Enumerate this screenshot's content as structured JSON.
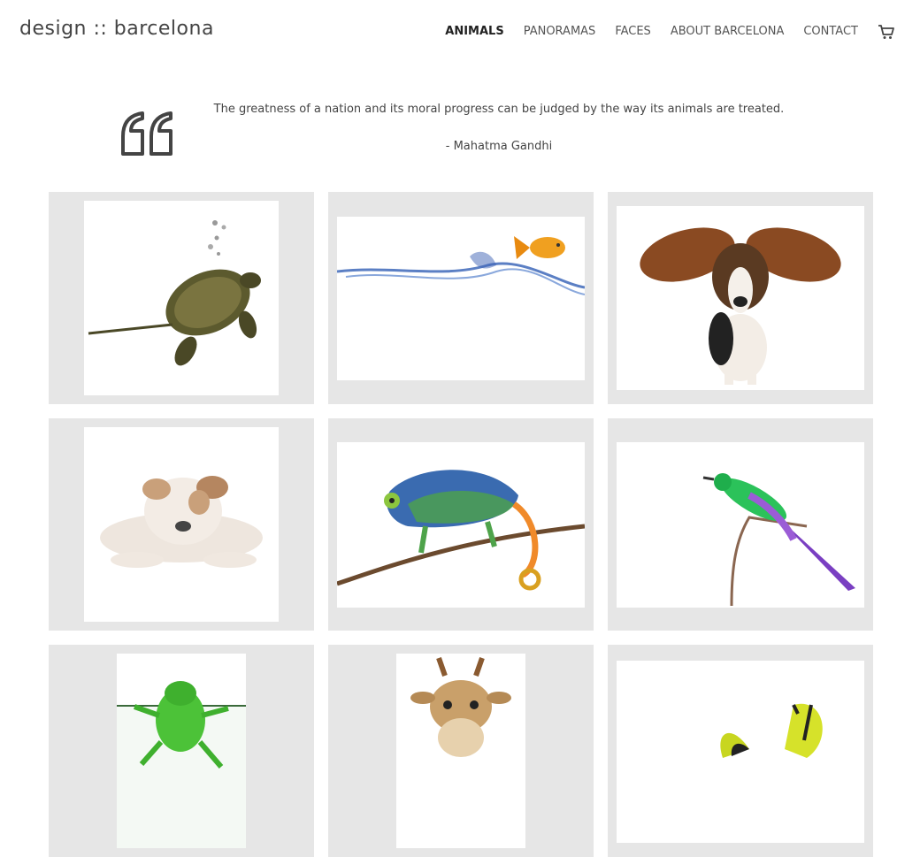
{
  "brand": "design :: barcelona",
  "nav": [
    {
      "label": "ANIMALS",
      "active": true
    },
    {
      "label": "PANORAMAS",
      "active": false
    },
    {
      "label": "FACES",
      "active": false
    },
    {
      "label": "ABOUT BARCELONA",
      "active": false
    },
    {
      "label": "CONTACT",
      "active": false
    }
  ],
  "cart_icon": "cart-icon",
  "quote": {
    "icon": "quote-icon",
    "text": "The greatness of a nation and its moral progress can be judged by the way its animals are treated.",
    "author": "- Mahatma Gandhi"
  },
  "gallery": [
    {
      "subject": "turtle"
    },
    {
      "subject": "goldfish"
    },
    {
      "subject": "basset-hound"
    },
    {
      "subject": "bulldog-puppy"
    },
    {
      "subject": "chameleon"
    },
    {
      "subject": "bee-eater-bird"
    },
    {
      "subject": "tree-frog"
    },
    {
      "subject": "giraffe"
    },
    {
      "subject": "butterfly"
    }
  ],
  "colors": {
    "card_bg": "#e6e6e6",
    "text": "#444444"
  }
}
